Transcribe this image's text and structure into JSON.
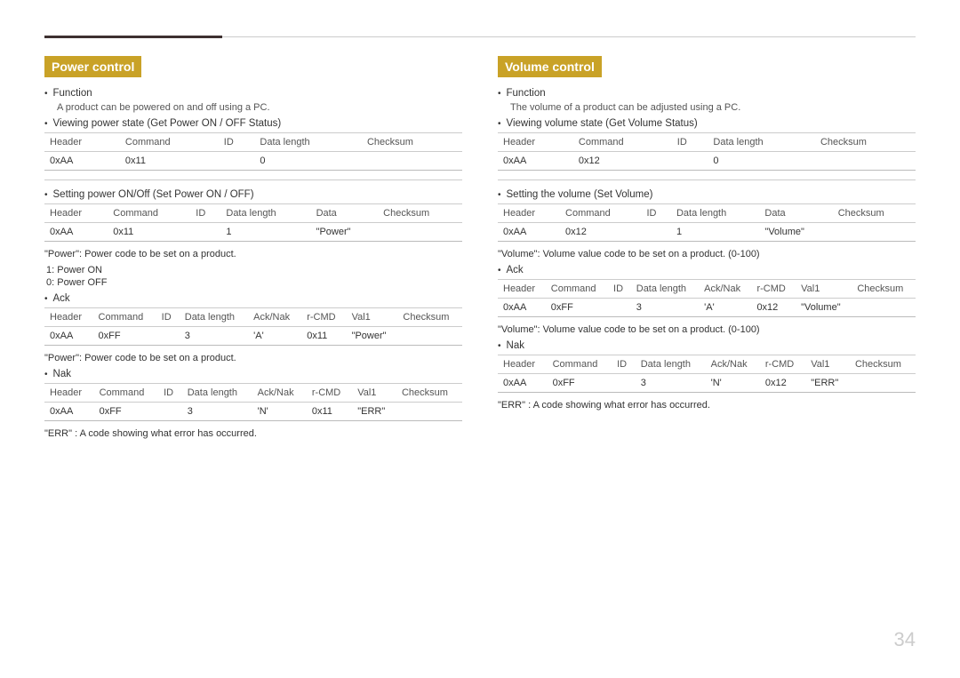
{
  "topRule": true,
  "pageNumber": "34",
  "leftSection": {
    "title": "Power control",
    "function": {
      "label": "Function",
      "description": "A product can be powered on and off using a PC."
    },
    "viewingPower": {
      "bulletText": "Viewing power state (Get Power ON / OFF Status)",
      "table1": {
        "headers": [
          "Header",
          "Command",
          "ID",
          "Data length",
          "Checksum"
        ],
        "rows": [
          [
            "0xAA",
            "0x11",
            "",
            "0",
            ""
          ]
        ]
      }
    },
    "settingPower": {
      "bulletText": "Setting power ON/Off (Set Power ON / OFF)",
      "table2": {
        "headers": [
          "Header",
          "Command",
          "ID",
          "Data length",
          "Data",
          "Checksum"
        ],
        "rows": [
          [
            "0xAA",
            "0x11",
            "",
            "1",
            "\"Power\"",
            ""
          ]
        ]
      }
    },
    "powerNote1": "\"Power\": Power code to be set on a product.",
    "powerValues": [
      "1: Power ON",
      "0: Power OFF"
    ],
    "ack": {
      "bulletText": "Ack",
      "table3": {
        "headers": [
          "Header",
          "Command",
          "ID",
          "Data length",
          "Ack/Nak",
          "r-CMD",
          "Val1",
          "Checksum"
        ],
        "rows": [
          [
            "0xAA",
            "0xFF",
            "",
            "3",
            "'A'",
            "0x11",
            "\"Power\"",
            ""
          ]
        ]
      }
    },
    "powerNote2": "\"Power\": Power code to be set on a product.",
    "nak": {
      "bulletText": "Nak",
      "table4": {
        "headers": [
          "Header",
          "Command",
          "ID",
          "Data length",
          "Ack/Nak",
          "r-CMD",
          "Val1",
          "Checksum"
        ],
        "rows": [
          [
            "0xAA",
            "0xFF",
            "",
            "3",
            "'N'",
            "0x11",
            "\"ERR\"",
            ""
          ]
        ]
      }
    },
    "errNote": "\"ERR\" : A code showing what error has occurred."
  },
  "rightSection": {
    "title": "Volume control",
    "function": {
      "label": "Function",
      "description": "The volume of a product can be adjusted using a PC."
    },
    "viewingVolume": {
      "bulletText": "Viewing volume state (Get Volume Status)",
      "table1": {
        "headers": [
          "Header",
          "Command",
          "ID",
          "Data length",
          "Checksum"
        ],
        "rows": [
          [
            "0xAA",
            "0x12",
            "",
            "0",
            ""
          ]
        ]
      }
    },
    "settingVolume": {
      "bulletText": "Setting the volume (Set Volume)",
      "table2": {
        "headers": [
          "Header",
          "Command",
          "ID",
          "Data length",
          "Data",
          "Checksum"
        ],
        "rows": [
          [
            "0xAA",
            "0x12",
            "",
            "1",
            "\"Volume\"",
            ""
          ]
        ]
      }
    },
    "volumeNote1": "\"Volume\": Volume value code to be set on a product. (0-100)",
    "ack": {
      "bulletText": "Ack",
      "table3": {
        "headers": [
          "Header",
          "Command",
          "ID",
          "Data length",
          "Ack/Nak",
          "r-CMD",
          "Val1",
          "Checksum"
        ],
        "rows": [
          [
            "0xAA",
            "0xFF",
            "",
            "3",
            "'A'",
            "0x12",
            "\"Volume\"",
            ""
          ]
        ]
      }
    },
    "volumeNote2": "\"Volume\": Volume value code to be set on a product. (0-100)",
    "nak": {
      "bulletText": "Nak",
      "table4": {
        "headers": [
          "Header",
          "Command",
          "ID",
          "Data length",
          "Ack/Nak",
          "r-CMD",
          "Val1",
          "Checksum"
        ],
        "rows": [
          [
            "0xAA",
            "0xFF",
            "",
            "3",
            "'N'",
            "0x12",
            "\"ERR\"",
            ""
          ]
        ]
      }
    },
    "errNote": "\"ERR\" : A code showing what error has occurred."
  }
}
